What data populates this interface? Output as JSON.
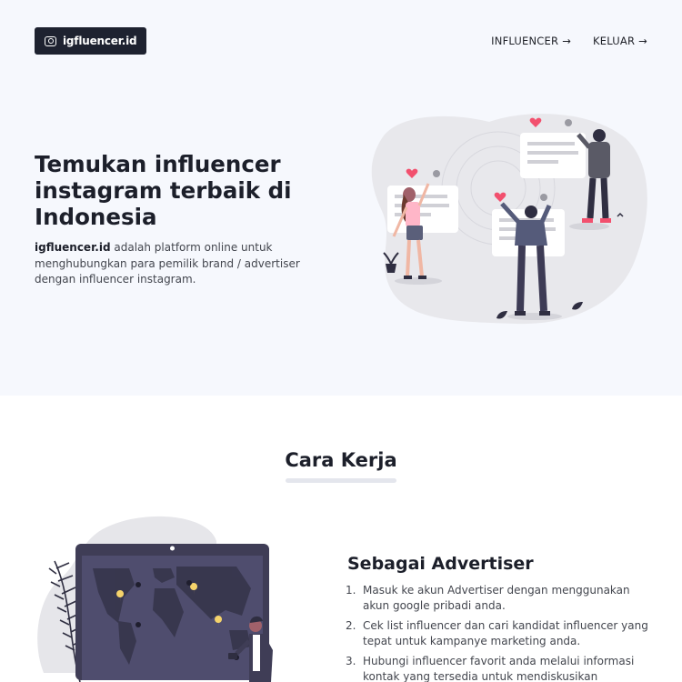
{
  "header": {
    "logo": {
      "icon": "camera-icon",
      "label": "igfluencer.id"
    },
    "nav": [
      {
        "label": "INFLUENCER",
        "icon": "arrow-right-icon"
      },
      {
        "label": "KELUAR",
        "icon": "arrow-right-icon"
      }
    ]
  },
  "hero": {
    "title": "Temukan influencer instagram terbaik di Indonesia",
    "brand": "igfluencer.id",
    "description": "adalah platform online untuk menghubungkan para pemilik brand / advertiser dengan influencer instagram."
  },
  "how_it_works": {
    "title": "Cara Kerja",
    "advertiser": {
      "title": "Sebagai Advertiser",
      "steps": [
        {
          "num": "1.",
          "text": "Masuk ke akun Advertiser dengan menggunakan akun google pribadi anda."
        },
        {
          "num": "2.",
          "text": "Cek list influencer dan cari kandidat influencer yang tepat untuk kampanye marketing anda."
        },
        {
          "num": "3.",
          "text": "Hubungi influencer favorit anda melalui informasi kontak yang tersedia untuk mendiskusikan"
        }
      ]
    }
  },
  "colors": {
    "hero_bg": "#f6f8fd",
    "dark": "#1e2230",
    "heart": "#f2506e",
    "illustration_blob": "#e6e6ea"
  }
}
